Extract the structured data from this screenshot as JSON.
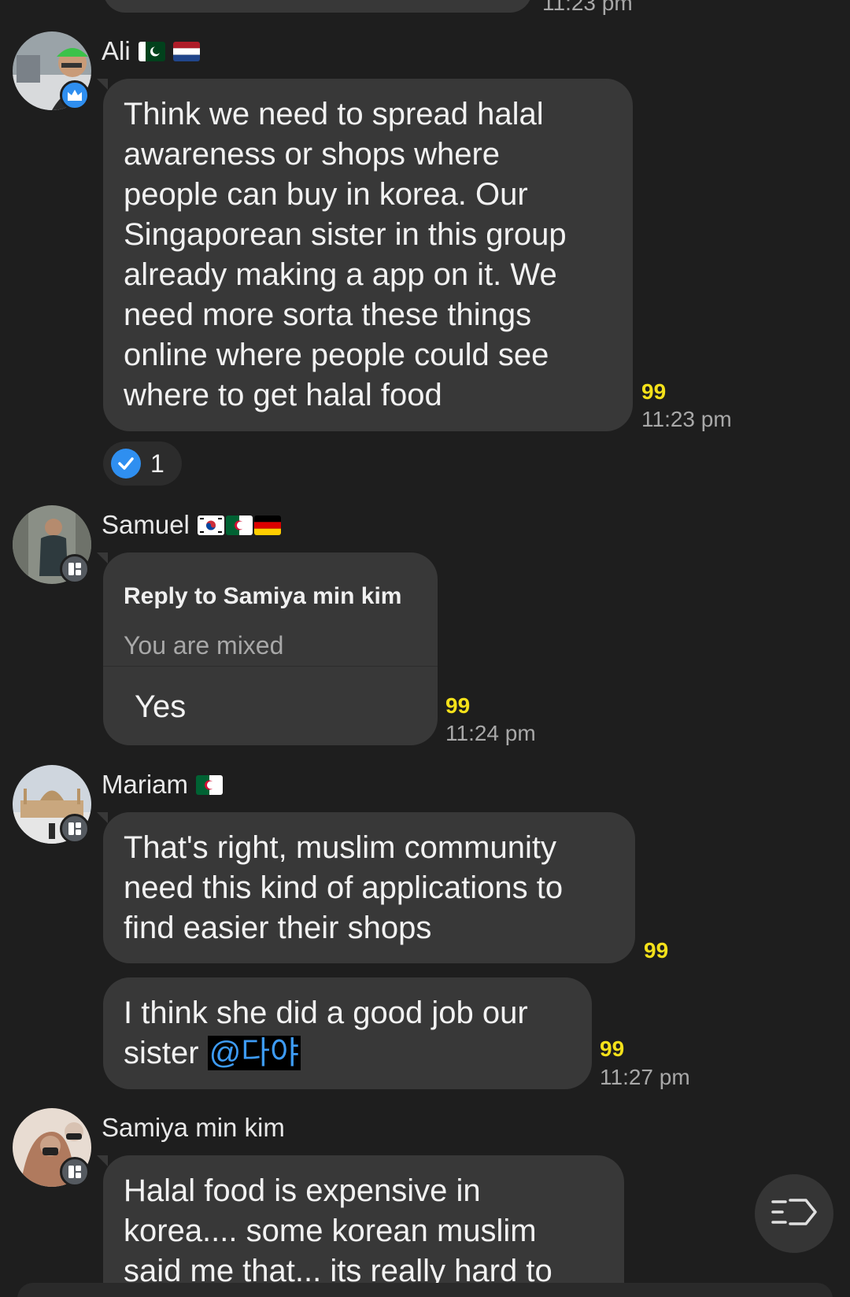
{
  "top": {
    "time": "11:23 pm"
  },
  "messages": [
    {
      "sender": "Ali",
      "flags": [
        "pakistan-flag",
        "netherlands-flag"
      ],
      "badge": "crown-icon",
      "text": "Think we need to spread halal\nawareness or shops where\npeople can buy in korea. Our\nSingaporean sister in this group\nalready making a app on it. We\nneed more sorta these things\nonline where people could see\nwhere to get halal food",
      "count": "99",
      "time": "11:23 pm",
      "reaction": {
        "icon": "check-icon",
        "count": "1"
      }
    },
    {
      "sender": "Samuel",
      "flags": [
        "south-korea-flag",
        "algeria-flag",
        "germany-flag"
      ],
      "badge": "card-icon",
      "reply_to": "Reply to Samiya  min kim",
      "reply_text": "You are mixed",
      "text": "Yes",
      "count": "99",
      "time": "11:24 pm"
    },
    {
      "sender": "Mariam",
      "flags": [
        "algeria-flag"
      ],
      "badge": "card-icon",
      "text": "That's right, muslim community\nneed this kind of applications to\nfind easier their shops",
      "count": "99"
    },
    {
      "text_prefix": "I think she did a good job our\nsister ",
      "mention": "@다야",
      "count": "99",
      "time": "11:27 pm"
    },
    {
      "sender": "Samiya  min kim",
      "badge": "card-icon",
      "text": "Halal food is expensive  in\nkorea.... some korean muslim\nsaid me that... its really  hard to"
    }
  ],
  "fab": {
    "icon": "tag-list-icon"
  },
  "colors": {
    "background": "#1e1e1e",
    "bubble": "#383838",
    "count": "#f4e11a",
    "time": "#a8a8a8",
    "accent": "#2f8ff0",
    "mention": "#3d9bf5"
  }
}
